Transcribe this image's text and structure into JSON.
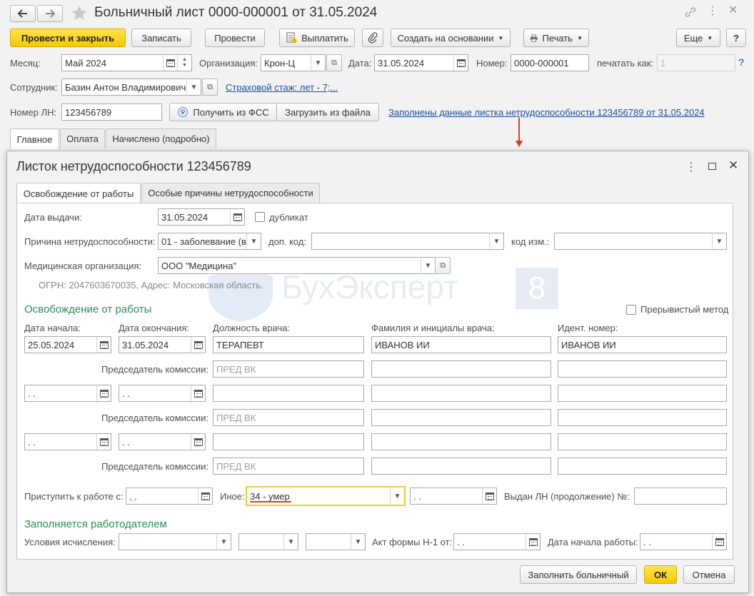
{
  "window": {
    "title": "Больничный лист 0000-000001 от 31.05.2024",
    "back_icon": "arrow-left-icon",
    "forward_icon": "arrow-right-icon",
    "favorite_icon": "star-icon"
  },
  "toolbar": {
    "post_close": "Провести и закрыть",
    "save": "Записать",
    "post": "Провести",
    "pay": "Выплатить",
    "create_based": "Создать на основании",
    "print": "Печать",
    "more": "Еще",
    "help": "?"
  },
  "header": {
    "month_label": "Месяц:",
    "month_value": "Май 2024",
    "org_label": "Организация:",
    "org_value": "Крон-Ц",
    "date_label": "Дата:",
    "date_value": "31.05.2024",
    "number_label": "Номер:",
    "number_value": "0000-000001",
    "print_as_label": "печатать как:",
    "print_as_value": "1",
    "employee_label": "Сотрудник:",
    "employee_value": "Базин Антон Владимирович",
    "insurance_link": "Страховой стаж: лет - 7;...",
    "ln_label": "Номер ЛН:",
    "ln_value": "123456789",
    "fss_button": "Получить из ФСС",
    "file_button": "Загрузить из файла",
    "filled_link": "Заполнены данные листка нетрудоспособности 123456789 от 31.05.2024"
  },
  "main_tabs": [
    "Главное",
    "Оплата",
    "Начислено (подробно)"
  ],
  "dialog": {
    "title": "Листок нетрудоспособности 123456789",
    "tabs": [
      "Освобождение от работы",
      "Особые причины нетрудоспособности"
    ],
    "issue_date_label": "Дата выдачи:",
    "issue_date": "31.05.2024",
    "duplicate_label": "дубликат",
    "reason_label": "Причина нетрудоспособности:",
    "reason_value": "01 - заболевание (в",
    "extra_code_label": "доп. код:",
    "change_code_label": "код изм.:",
    "med_org_label": "Медицинская организация:",
    "med_org_value": "ООО \"Медицина\"",
    "ogrn_text": "ОГРН: 2047603670035, Адрес: Московская область.",
    "release_section": "Освобождение от работы",
    "intermittent_label": "Прерывистый метод",
    "col_start": "Дата начала:",
    "col_end": "Дата окончания:",
    "col_position": "Должность врача:",
    "col_doctor": "Фамилия и инициалы врача:",
    "col_id": "Идент.  номер:",
    "row1_start": "25.05.2024",
    "row1_end": "31.05.2024",
    "row1_position": "ТЕРАПЕВТ",
    "row1_doctor": "ИВАНОВ ИИ",
    "row1_id": "ИВАНОВ ИИ",
    "chair_label": "Председатель комиссии:",
    "chair_placeholder": "ПРЕД ВК",
    "empty_date": " .  .",
    "return_label": "Приступить к работе с:",
    "other_label": "Иное:",
    "other_value": "34 - умер",
    "continued_label": "Выдан ЛН (продолжение) №:",
    "employer_section": "Заполняется работодателем",
    "calc_conditions_label": "Условия исчисления:",
    "act_label": "Акт формы Н-1 от:",
    "work_start_label": "Дата начала работы:",
    "fill_button": "Заполнить больничный",
    "ok_button": "ОК",
    "cancel_button": "Отмена"
  },
  "watermark": {
    "text": "БухЭксперт",
    "badge": "8"
  },
  "colors": {
    "accent_yellow": "#f6c800",
    "section_green": "#2a8f52",
    "link_blue": "#1a4c9b",
    "annotation_red": "#d93a2b"
  }
}
